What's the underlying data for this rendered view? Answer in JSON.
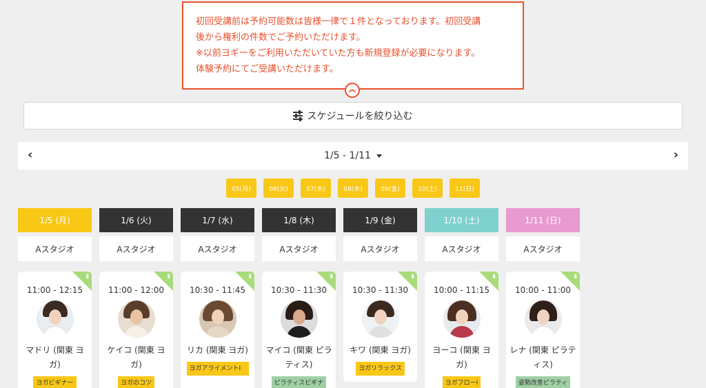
{
  "notice": {
    "lines": [
      "初回受講前は予約可能数は皆様一律で１件となっております。初回受講",
      "後から権利の件数でご予約いただけます。",
      "※以前ヨギーをご利用いただいていた方も新規登録が必要になります。",
      "体験予約にてご受講いただけます。"
    ]
  },
  "filter": {
    "label": "スケジュールを絞り込む"
  },
  "week": {
    "range": "1/5 - 1/11",
    "prev": "‹",
    "next": "›"
  },
  "chips": [
    "05(月)",
    "06(火)",
    "07(水)",
    "08(木)",
    "09(金)",
    "10(土)",
    "11(日)"
  ],
  "days": [
    {
      "label": "1/5 (月)",
      "studio": "Aスタジオ"
    },
    {
      "label": "1/6 (火)",
      "studio": "Aスタジオ"
    },
    {
      "label": "1/7 (水)",
      "studio": "Aスタジオ"
    },
    {
      "label": "1/8 (木)",
      "studio": "Aスタジオ"
    },
    {
      "label": "1/9 (金)",
      "studio": "Aスタジオ"
    },
    {
      "label": "1/10 (土)",
      "studio": "Aスタジオ"
    },
    {
      "label": "1/11 (日)",
      "studio": "Aスタジオ"
    }
  ],
  "classes": [
    {
      "time": "11:00 - 12:15",
      "name": "マドリ (関東 ヨガ)",
      "tag": "ヨガビギナー"
    },
    {
      "time": "11:00 - 12:00",
      "name": "ケイコ (関東 ヨガ)",
      "tag": "ヨガのコツ"
    },
    {
      "time": "10:30 - 11:45",
      "name": "リカ (関東 ヨガ)",
      "tag": "ヨガアライメントI"
    },
    {
      "time": "10:30 - 11:30",
      "name": "マイコ (関東 ピラティス)",
      "tag": "ピラティスビギナ"
    },
    {
      "time": "10:30 - 11:30",
      "name": "キワ (関東 ヨガ)",
      "tag": "ヨガリラックス"
    },
    {
      "time": "10:00 - 11:15",
      "name": "ヨーコ (関東 ヨガ)",
      "tag": "ヨガフローI"
    },
    {
      "time": "10:00 - 11:00",
      "name": "レナ (関東 ピラティス)",
      "tag": "姿勢改善ピラティ"
    }
  ],
  "colors": {
    "accent": "#e8502d",
    "chip": "#f9c716",
    "saturday": "#7fd1cd",
    "sunday": "#e99ad0",
    "beginner_badge": "#a8dc7b"
  },
  "icons": {
    "collapse": "double-chevron-up-icon",
    "filter": "sliders-icon",
    "beginner": "beginner-leaf-icon"
  }
}
